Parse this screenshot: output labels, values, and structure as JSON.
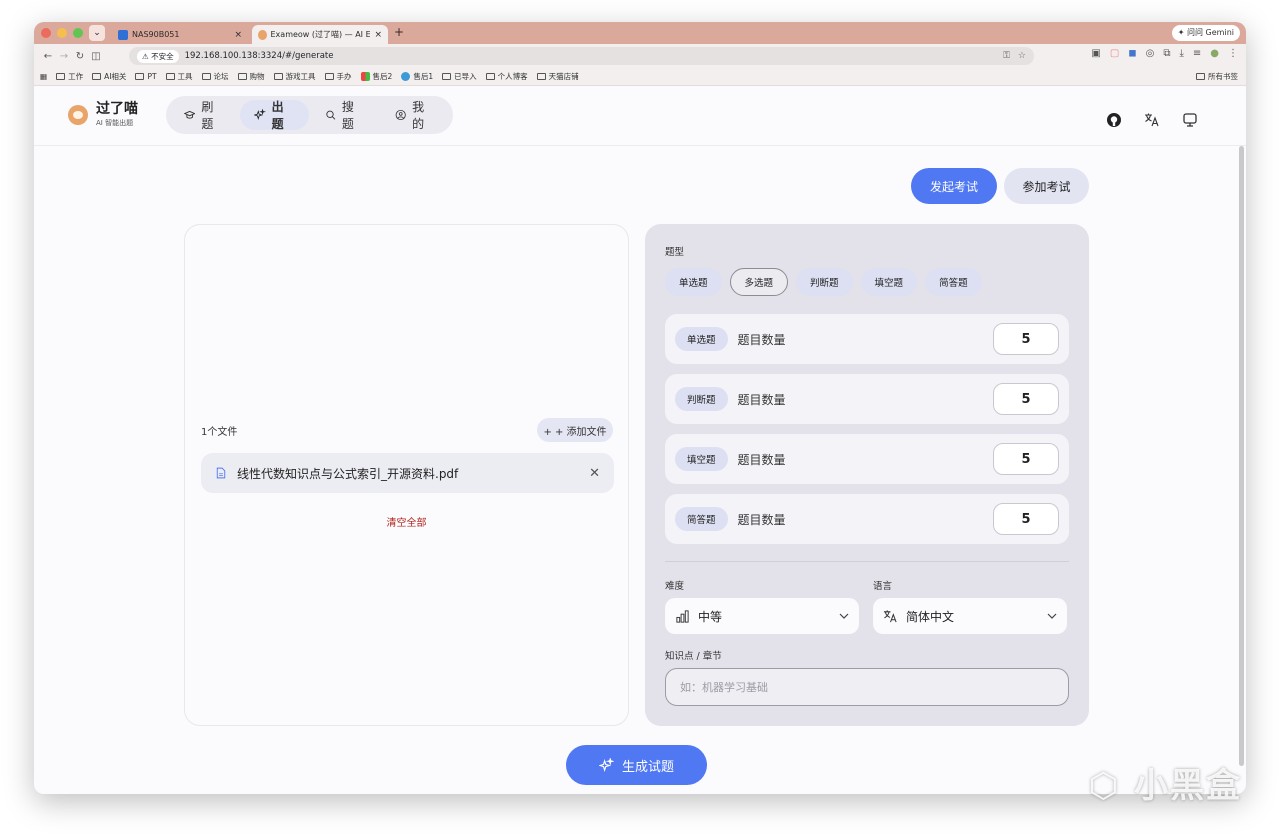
{
  "browser": {
    "tabs": [
      {
        "title": "NAS90B051",
        "close": "×"
      },
      {
        "title": "Exameow (过了喵) — AI Exam",
        "close": "×"
      }
    ],
    "new_tab": "+",
    "gemini_label": "问问 Gemini",
    "insecure_label": "不安全",
    "url": "192.168.100.138:3324/#/generate",
    "bookmarks": [
      "工作",
      "AI相关",
      "PT",
      "工具",
      "论坛",
      "购物",
      "游戏工具",
      "手办",
      "售后2",
      "售后1",
      "已导入",
      "个人博客",
      "天猫店铺"
    ],
    "all_bookmarks": "所有书签"
  },
  "header": {
    "logo_title": "过了喵",
    "logo_subtitle": "AI 智能出题",
    "nav": [
      {
        "label": "刷题",
        "icon": "graduation-cap-icon"
      },
      {
        "label": "出题",
        "icon": "sparkles-icon"
      },
      {
        "label": "搜题",
        "icon": "search-icon"
      },
      {
        "label": "我的",
        "icon": "user-icon"
      }
    ],
    "active_nav": "出题",
    "right_icons": [
      "github-icon",
      "translate-icon",
      "monitor-icon"
    ]
  },
  "actions": {
    "start_exam": "发起考试",
    "join_exam": "参加考试"
  },
  "files": {
    "count_label": "1个文件",
    "add_file": "+ + 添加文件",
    "items": [
      {
        "name": "线性代数知识点与公式索引_开源资料.pdf"
      }
    ],
    "clear_all": "清空全部"
  },
  "config": {
    "type_label": "题型",
    "types": [
      "单选题",
      "多选题",
      "判断题",
      "填空题",
      "简答题"
    ],
    "selected_type": "多选题",
    "count_rows": [
      {
        "type": "单选题",
        "label": "题目数量",
        "value": "5"
      },
      {
        "type": "判断题",
        "label": "题目数量",
        "value": "5"
      },
      {
        "type": "填空题",
        "label": "题目数量",
        "value": "5"
      },
      {
        "type": "简答题",
        "label": "题目数量",
        "value": "5"
      }
    ],
    "difficulty_label": "难度",
    "difficulty_value": "中等",
    "language_label": "语言",
    "language_value": "简体中文",
    "knowledge_label": "知识点 / 章节",
    "knowledge_placeholder": "如：机器学习基础"
  },
  "generate_button": "生成试题",
  "watermark": "小黑盒",
  "colors": {
    "primary": "#4f78f2",
    "chip": "#dde0f2",
    "panel": "#e3e1ea",
    "danger": "#b0261e"
  }
}
